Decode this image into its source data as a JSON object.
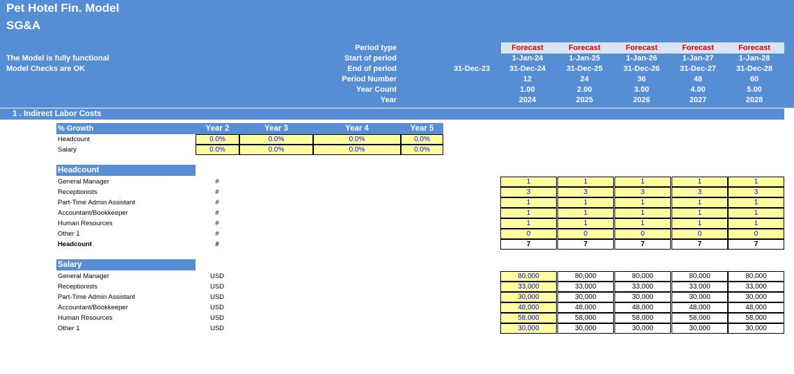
{
  "header": {
    "title": "Pet Hotel Fin. Model",
    "subtitle": "SG&A",
    "status1": "The Model is fully functional",
    "status2": "Model Checks are OK",
    "row_labels": [
      "Period type",
      "Start of period",
      "End of period",
      "Period Number",
      "Year Count",
      "Year"
    ],
    "prior_end": "31-Dec-23",
    "columns": [
      {
        "type": "Forecast",
        "start": "1-Jan-24",
        "end": "31-Dec-24",
        "period": "12",
        "count": "1.00",
        "year": "2024"
      },
      {
        "type": "Forecast",
        "start": "1-Jan-25",
        "end": "31-Dec-25",
        "period": "24",
        "count": "2.00",
        "year": "2025"
      },
      {
        "type": "Forecast",
        "start": "1-Jan-26",
        "end": "31-Dec-26",
        "period": "36",
        "count": "3.00",
        "year": "2026"
      },
      {
        "type": "Forecast",
        "start": "1-Jan-27",
        "end": "31-Dec-27",
        "period": "48",
        "count": "4.00",
        "year": "2027"
      },
      {
        "type": "Forecast",
        "start": "1-Jan-28",
        "end": "31-Dec-28",
        "period": "60",
        "count": "5.00",
        "year": "2028"
      }
    ]
  },
  "section": {
    "title": "1 . Indirect Labor Costs"
  },
  "growth": {
    "title": "% Growth",
    "years": [
      "Year 2",
      "Year 3",
      "Year 4",
      "Year 5"
    ],
    "rows": [
      {
        "label": "Headcount",
        "values": [
          "0.0%",
          "0.0%",
          "0.0%",
          "0.0%"
        ]
      },
      {
        "label": "Salary",
        "values": [
          "0.0%",
          "0.0%",
          "0.0%",
          "0.0%"
        ]
      }
    ]
  },
  "headcount": {
    "title": "Headcount",
    "rows": [
      {
        "label": "General Manager",
        "unit": "#",
        "values": [
          "1",
          "1",
          "1",
          "1",
          "1"
        ]
      },
      {
        "label": "Receptionists",
        "unit": "#",
        "values": [
          "3",
          "3",
          "3",
          "3",
          "3"
        ]
      },
      {
        "label": "Part-Time Admin Assistant",
        "unit": "#",
        "values": [
          "1",
          "1",
          "1",
          "1",
          "1"
        ]
      },
      {
        "label": "Accountant/Bookkeeper",
        "unit": "#",
        "values": [
          "1",
          "1",
          "1",
          "1",
          "1"
        ]
      },
      {
        "label": "Human Resources",
        "unit": "#",
        "values": [
          "1",
          "1",
          "1",
          "1",
          "1"
        ]
      },
      {
        "label": "Other 1",
        "unit": "#",
        "values": [
          "0",
          "0",
          "0",
          "0",
          "0"
        ]
      }
    ],
    "total": {
      "label": "Headcount",
      "unit": "#",
      "values": [
        "7",
        "7",
        "7",
        "7",
        "7"
      ]
    }
  },
  "salary": {
    "title": "Salary",
    "rows": [
      {
        "label": "General Manager",
        "unit": "USD",
        "values": [
          "80,000",
          "80,000",
          "80,000",
          "80,000",
          "80,000"
        ]
      },
      {
        "label": "Receptionists",
        "unit": "USD",
        "values": [
          "33,000",
          "33,000",
          "33,000",
          "33,000",
          "33,000"
        ]
      },
      {
        "label": "Part-Time Admin Assistant",
        "unit": "USD",
        "values": [
          "30,000",
          "30,000",
          "30,000",
          "30,000",
          "30,000"
        ]
      },
      {
        "label": "Accountant/Bookkeeper",
        "unit": "USD",
        "values": [
          "48,000",
          "48,000",
          "48,000",
          "48,000",
          "48,000"
        ]
      },
      {
        "label": "Human Resources",
        "unit": "USD",
        "values": [
          "58,000",
          "58,000",
          "58,000",
          "58,000",
          "58,000"
        ]
      },
      {
        "label": "Other 1",
        "unit": "USD",
        "values": [
          "30,000",
          "30,000",
          "30,000",
          "30,000",
          "30,000"
        ]
      }
    ]
  }
}
